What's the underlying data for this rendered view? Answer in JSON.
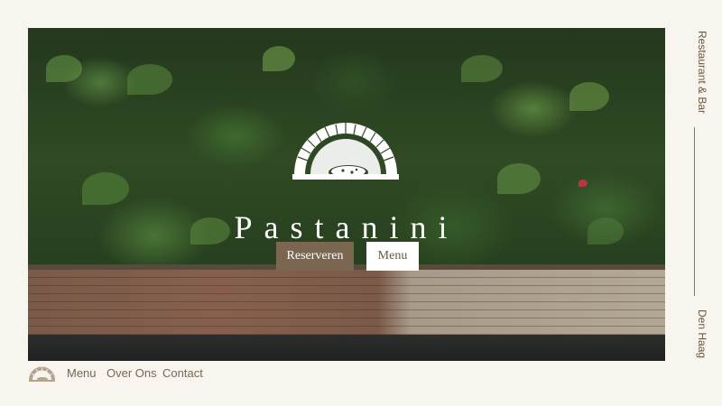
{
  "hero": {
    "brand": "Pastanini",
    "reserve_label": "Reserveren",
    "menu_label": "Menu"
  },
  "side": {
    "tagline": "Restaurant & Bar",
    "city": "Den Haag"
  },
  "footer_nav": {
    "items": [
      "Menu",
      "Over Ons",
      "Contact"
    ]
  },
  "icons": {
    "logo": "pizza-oven-logo-icon"
  },
  "colors": {
    "background": "#f8f5ee",
    "accent": "#7a6651",
    "text_brown": "#6b5840"
  }
}
